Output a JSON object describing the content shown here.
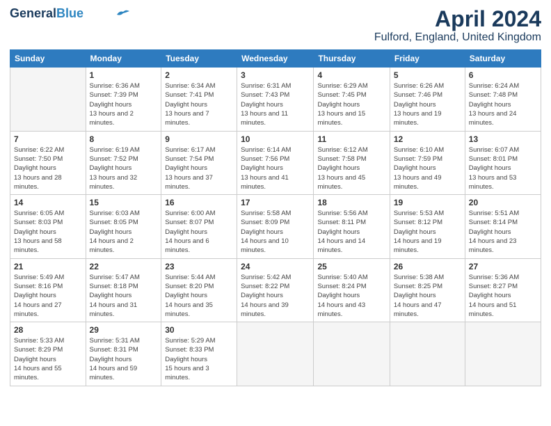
{
  "header": {
    "logo_general": "General",
    "logo_blue": "Blue",
    "month": "April 2024",
    "location": "Fulford, England, United Kingdom"
  },
  "days_of_week": [
    "Sunday",
    "Monday",
    "Tuesday",
    "Wednesday",
    "Thursday",
    "Friday",
    "Saturday"
  ],
  "weeks": [
    [
      {
        "day": "",
        "empty": true
      },
      {
        "day": "1",
        "sunrise": "6:36 AM",
        "sunset": "7:39 PM",
        "daylight": "13 hours and 2 minutes."
      },
      {
        "day": "2",
        "sunrise": "6:34 AM",
        "sunset": "7:41 PM",
        "daylight": "13 hours and 7 minutes."
      },
      {
        "day": "3",
        "sunrise": "6:31 AM",
        "sunset": "7:43 PM",
        "daylight": "13 hours and 11 minutes."
      },
      {
        "day": "4",
        "sunrise": "6:29 AM",
        "sunset": "7:45 PM",
        "daylight": "13 hours and 15 minutes."
      },
      {
        "day": "5",
        "sunrise": "6:26 AM",
        "sunset": "7:46 PM",
        "daylight": "13 hours and 19 minutes."
      },
      {
        "day": "6",
        "sunrise": "6:24 AM",
        "sunset": "7:48 PM",
        "daylight": "13 hours and 24 minutes."
      }
    ],
    [
      {
        "day": "7",
        "sunrise": "6:22 AM",
        "sunset": "7:50 PM",
        "daylight": "13 hours and 28 minutes."
      },
      {
        "day": "8",
        "sunrise": "6:19 AM",
        "sunset": "7:52 PM",
        "daylight": "13 hours and 32 minutes."
      },
      {
        "day": "9",
        "sunrise": "6:17 AM",
        "sunset": "7:54 PM",
        "daylight": "13 hours and 37 minutes."
      },
      {
        "day": "10",
        "sunrise": "6:14 AM",
        "sunset": "7:56 PM",
        "daylight": "13 hours and 41 minutes."
      },
      {
        "day": "11",
        "sunrise": "6:12 AM",
        "sunset": "7:58 PM",
        "daylight": "13 hours and 45 minutes."
      },
      {
        "day": "12",
        "sunrise": "6:10 AM",
        "sunset": "7:59 PM",
        "daylight": "13 hours and 49 minutes."
      },
      {
        "day": "13",
        "sunrise": "6:07 AM",
        "sunset": "8:01 PM",
        "daylight": "13 hours and 53 minutes."
      }
    ],
    [
      {
        "day": "14",
        "sunrise": "6:05 AM",
        "sunset": "8:03 PM",
        "daylight": "13 hours and 58 minutes."
      },
      {
        "day": "15",
        "sunrise": "6:03 AM",
        "sunset": "8:05 PM",
        "daylight": "14 hours and 2 minutes."
      },
      {
        "day": "16",
        "sunrise": "6:00 AM",
        "sunset": "8:07 PM",
        "daylight": "14 hours and 6 minutes."
      },
      {
        "day": "17",
        "sunrise": "5:58 AM",
        "sunset": "8:09 PM",
        "daylight": "14 hours and 10 minutes."
      },
      {
        "day": "18",
        "sunrise": "5:56 AM",
        "sunset": "8:11 PM",
        "daylight": "14 hours and 14 minutes."
      },
      {
        "day": "19",
        "sunrise": "5:53 AM",
        "sunset": "8:12 PM",
        "daylight": "14 hours and 19 minutes."
      },
      {
        "day": "20",
        "sunrise": "5:51 AM",
        "sunset": "8:14 PM",
        "daylight": "14 hours and 23 minutes."
      }
    ],
    [
      {
        "day": "21",
        "sunrise": "5:49 AM",
        "sunset": "8:16 PM",
        "daylight": "14 hours and 27 minutes."
      },
      {
        "day": "22",
        "sunrise": "5:47 AM",
        "sunset": "8:18 PM",
        "daylight": "14 hours and 31 minutes."
      },
      {
        "day": "23",
        "sunrise": "5:44 AM",
        "sunset": "8:20 PM",
        "daylight": "14 hours and 35 minutes."
      },
      {
        "day": "24",
        "sunrise": "5:42 AM",
        "sunset": "8:22 PM",
        "daylight": "14 hours and 39 minutes."
      },
      {
        "day": "25",
        "sunrise": "5:40 AM",
        "sunset": "8:24 PM",
        "daylight": "14 hours and 43 minutes."
      },
      {
        "day": "26",
        "sunrise": "5:38 AM",
        "sunset": "8:25 PM",
        "daylight": "14 hours and 47 minutes."
      },
      {
        "day": "27",
        "sunrise": "5:36 AM",
        "sunset": "8:27 PM",
        "daylight": "14 hours and 51 minutes."
      }
    ],
    [
      {
        "day": "28",
        "sunrise": "5:33 AM",
        "sunset": "8:29 PM",
        "daylight": "14 hours and 55 minutes."
      },
      {
        "day": "29",
        "sunrise": "5:31 AM",
        "sunset": "8:31 PM",
        "daylight": "14 hours and 59 minutes."
      },
      {
        "day": "30",
        "sunrise": "5:29 AM",
        "sunset": "8:33 PM",
        "daylight": "15 hours and 3 minutes."
      },
      {
        "day": "",
        "empty": true
      },
      {
        "day": "",
        "empty": true
      },
      {
        "day": "",
        "empty": true
      },
      {
        "day": "",
        "empty": true
      }
    ]
  ]
}
